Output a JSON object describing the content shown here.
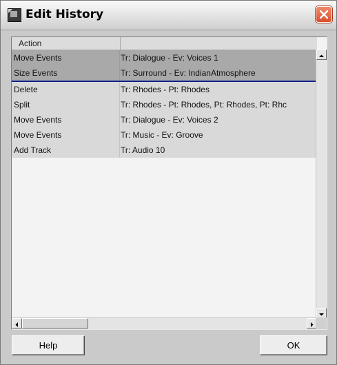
{
  "window": {
    "title": "Edit History",
    "icons": {
      "app": "edit-history-app-icon",
      "close": "close-icon"
    }
  },
  "list": {
    "columns": [
      {
        "label": "Action"
      },
      {
        "label": ""
      }
    ],
    "rows": [
      {
        "action": "Move Events",
        "detail": "Tr: Dialogue - Ev: Voices 1",
        "selected": true
      },
      {
        "action": "Size Events",
        "detail": "Tr: Surround - Ev: IndianAtmosphere",
        "selected": true
      },
      {
        "action": "Delete",
        "detail": "Tr: Rhodes - Pt: Rhodes",
        "selected": false
      },
      {
        "action": "Split",
        "detail": "Tr: Rhodes - Pt: Rhodes, Pt: Rhodes, Pt: Rhc",
        "selected": false
      },
      {
        "action": "Move Events",
        "detail": "Tr: Dialogue - Ev: Voices 2",
        "selected": false
      },
      {
        "action": "Move Events",
        "detail": "Tr: Music - Ev: Groove",
        "selected": false
      },
      {
        "action": "Add Track",
        "detail": "Tr: Audio 10",
        "selected": false
      }
    ],
    "colors": {
      "selected_row": "#a9a9a9",
      "row": "#d9d9d9",
      "history_marker": "#10208a"
    }
  },
  "buttons": {
    "help": "Help",
    "ok": "OK"
  }
}
